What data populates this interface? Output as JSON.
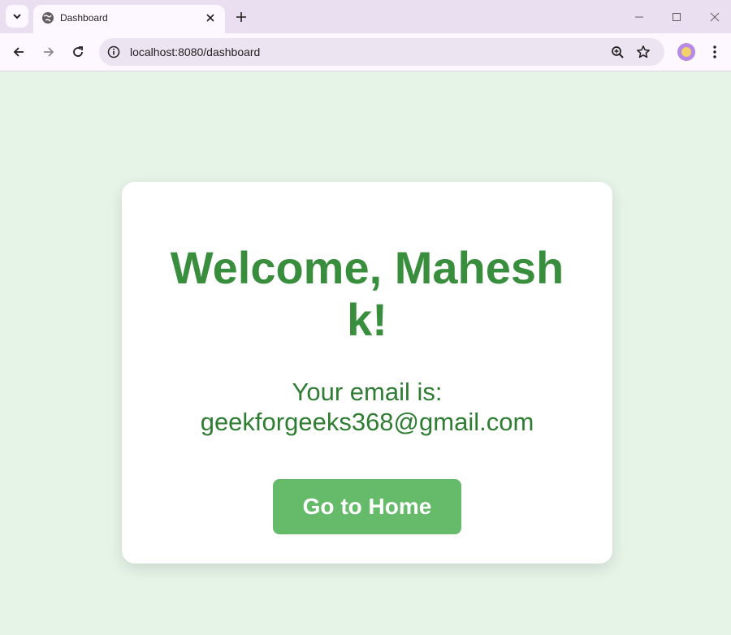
{
  "browser": {
    "tab": {
      "title": "Dashboard",
      "favicon": "globe-icon"
    },
    "address_bar": {
      "url": "localhost:8080/dashboard"
    },
    "colors": {
      "tabstrip": "#e9dff0",
      "toolbar": "#fdf8ff",
      "omnibox": "#ede4f2"
    }
  },
  "page": {
    "background": "#e6f4e8",
    "card": {
      "welcome": "Welcome, Mahesh k!",
      "email_line_1": "Your email is:",
      "email_line_2": "geekforgeeks368@gmail.com",
      "home_button": "Go to Home"
    },
    "colors": {
      "heading": "#388e3c",
      "text": "#2e7d32",
      "button": "#66bb6a"
    }
  }
}
